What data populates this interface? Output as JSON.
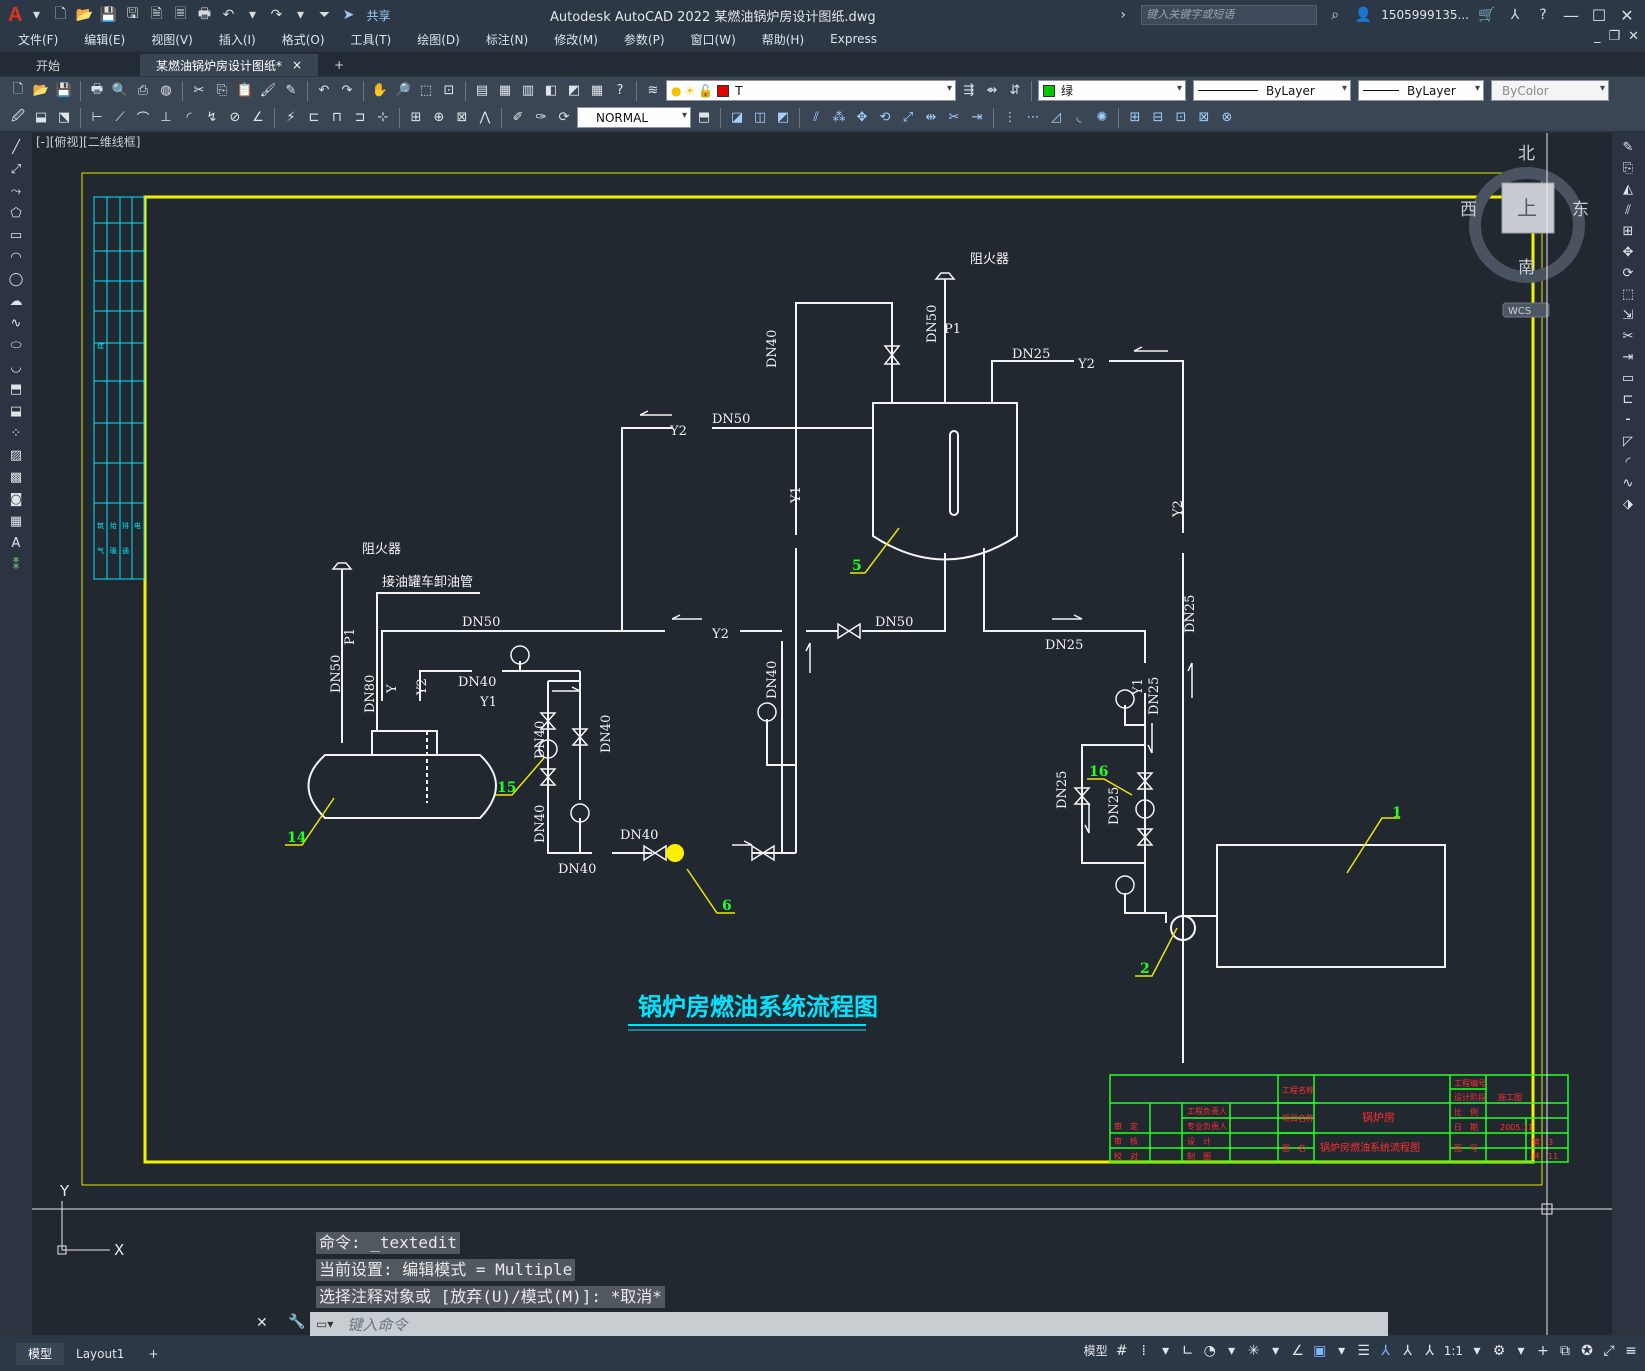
{
  "app": {
    "title": "Autodesk AutoCAD 2022    某燃油锅炉房设计图纸.dwg",
    "share_label": "共享",
    "search_placeholder": "键入关键字或短语",
    "user": "1505999135...",
    "colors": {
      "accent": "#e0301e",
      "yellow_frame": "#f2f200",
      "cyan": "#00e4ff",
      "green": "#24ff24",
      "canvas_bg": "#212830"
    }
  },
  "menu": [
    "文件(F)",
    "编辑(E)",
    "视图(V)",
    "插入(I)",
    "格式(O)",
    "工具(T)",
    "绘图(D)",
    "标注(N)",
    "修改(M)",
    "参数(P)",
    "窗口(W)",
    "帮助(H)",
    "Express"
  ],
  "tabs": {
    "start": "开始",
    "active": "某燃油锅炉房设计图纸*",
    "close": "×",
    "add": "+"
  },
  "properties": {
    "layer": "T",
    "color": "绿",
    "linetype": "ByLayer",
    "lineweight": "ByLayer",
    "plotstyle": "ByColor",
    "textstyle": "NORMAL"
  },
  "viewport_label": "[-][俯视][二维线框]",
  "viewcube": {
    "north": "北",
    "south": "南",
    "east": "东",
    "west": "西",
    "top": "上",
    "wcs": "WCS"
  },
  "ucs": {
    "x": "X",
    "y": "Y"
  },
  "drawing": {
    "title": "锅炉房燃油系统流程图",
    "labels": {
      "fire_arrester": "阻火器",
      "tanker_pipe": "接油罐车卸油管",
      "dn50": "DN50",
      "dn40": "DN40",
      "dn25": "DN25",
      "dn80": "DN80",
      "y1": "Y1",
      "y2": "Y2",
      "y": "Y",
      "p1": "P1"
    },
    "callouts": [
      "1",
      "2",
      "5",
      "6",
      "14",
      "15",
      "16"
    ],
    "title_block": {
      "project": "工程名称",
      "item": "项目名称",
      "item_value": "锅炉房",
      "drawing_name_label": "图　名",
      "drawing_name": "锅炉房燃油系统流程图",
      "project_no": "工程编号",
      "design_stage": "设计阶段",
      "stage_value": "施工图",
      "scale": "比　例",
      "date": "日　期",
      "date_value": "2005.11",
      "sheet_no": "图　号",
      "sheet": "第　3",
      "total": "共　11",
      "rows": [
        "审　定",
        "审　核",
        "校　对"
      ],
      "roles": [
        "工程负责人",
        "专业负责人",
        "设　计",
        "制　图"
      ]
    },
    "revision_col": [
      "建",
      "筑",
      "给",
      "排",
      "电",
      "气",
      "暖",
      "通"
    ]
  },
  "command": {
    "history": [
      "命令:  _textedit",
      "当前设置: 编辑模式 = Multiple",
      "选择注释对象或 [放弃(U)/模式(M)]: *取消*"
    ],
    "placeholder": "键入命令"
  },
  "status": {
    "tabs": [
      "模型",
      "Layout1"
    ],
    "add": "+",
    "model_label": "模型",
    "scale": "1:1"
  }
}
